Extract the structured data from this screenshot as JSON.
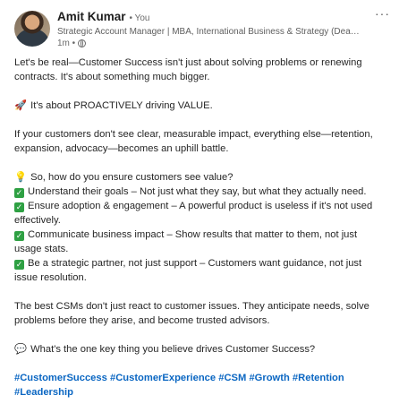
{
  "author": {
    "name": "Amit Kumar",
    "you_label": "• You",
    "headline": "Strategic Account Manager | MBA, International Business & Strategy (Deakin ...",
    "time": "1m •"
  },
  "menu_icon": "ellipsis-icon",
  "post": {
    "p1": "Let's be real—Customer Success isn't just about solving problems or renewing contracts. It's about something much bigger.",
    "p2_emoji": "🚀",
    "p2": "It's about PROACTIVELY driving VALUE.",
    "p3": "If your customers don't see clear, measurable impact, everything else—retention, expansion, advocacy—becomes an uphill battle.",
    "q_emoji": "💡",
    "question": "So, how do you ensure customers see value?",
    "check_glyph": "✓",
    "points": [
      "Understand their goals – Not just what they say, but what they actually need.",
      "Ensure adoption & engagement – A powerful product is useless if it's not used effectively.",
      "Communicate business impact – Show results that matter to them, not just usage stats.",
      "Be a strategic partner, not just support – Customers want guidance, not just issue resolution."
    ],
    "p4": "The best CSMs don't just react to customer issues. They anticipate needs, solve problems before they arise, and become trusted advisors.",
    "c_emoji": "💬",
    "closing": "What's the one key thing you believe drives Customer Success?",
    "hashtags": [
      "#CustomerSuccess",
      "#CustomerExperience",
      "#CSM",
      "#Growth",
      "#Retention",
      "#Leadership"
    ]
  },
  "colors": {
    "link": "#0a66c2",
    "check_bg": "#2ea043"
  }
}
